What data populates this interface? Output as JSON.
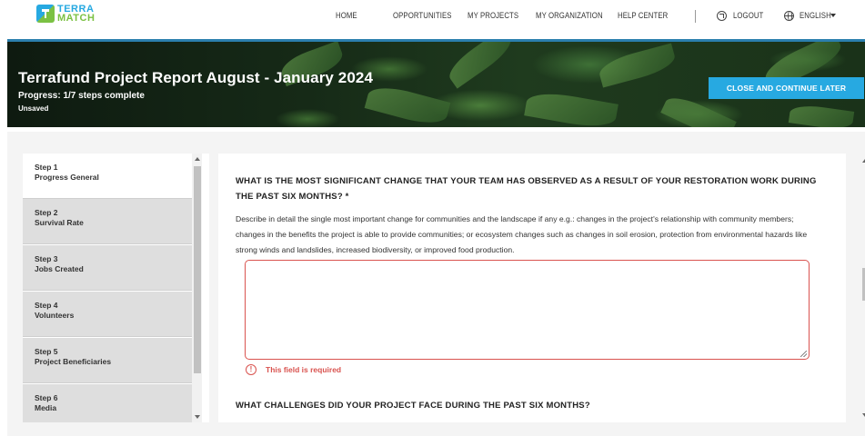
{
  "brand": {
    "line1": "TERRA",
    "line2": "MATCH"
  },
  "nav": {
    "home": "HOME",
    "opportunities": "OPPORTUNITIES",
    "my_projects": "MY PROJECTS",
    "my_organization": "MY ORGANIZATION",
    "help_center": "HELP CENTER",
    "logout": "LOGOUT",
    "language": "ENGLISH"
  },
  "banner": {
    "title": "Terrafund Project Report August - January 2024",
    "progress": "Progress: 1/7 steps complete",
    "status": "Unsaved",
    "close_button": "CLOSE AND CONTINUE LATER"
  },
  "steps": [
    {
      "num": "Step 1",
      "title": "Progress General",
      "active": true
    },
    {
      "num": "Step 2",
      "title": "Survival Rate",
      "active": false
    },
    {
      "num": "Step 3",
      "title": "Jobs Created",
      "active": false
    },
    {
      "num": "Step 4",
      "title": "Volunteers",
      "active": false
    },
    {
      "num": "Step 5",
      "title": "Project Beneficiaries",
      "active": false
    },
    {
      "num": "Step 6",
      "title": "Media",
      "active": false
    }
  ],
  "form": {
    "question1": "WHAT IS THE MOST SIGNIFICANT CHANGE THAT YOUR TEAM HAS OBSERVED AS A RESULT OF YOUR RESTORATION WORK DURING THE PAST SIX MONTHS? *",
    "question1_description": "Describe in detail the single most important change for communities and the landscape if any e.g.: changes in the project's relationship with community members; changes in the benefits the project is able to provide communities; or ecosystem changes such as changes in soil erosion, protection from environmental hazards like strong winds and landslides, increased biodiversity, or improved food production.",
    "answer1_value": "",
    "error_message": "This field is required",
    "question2": "WHAT CHALLENGES DID YOUR PROJECT FACE DURING THE PAST SIX MONTHS?"
  },
  "colors": {
    "accent": "#27a9e1",
    "brand_green": "#7bc143",
    "error": "#d9534f"
  }
}
